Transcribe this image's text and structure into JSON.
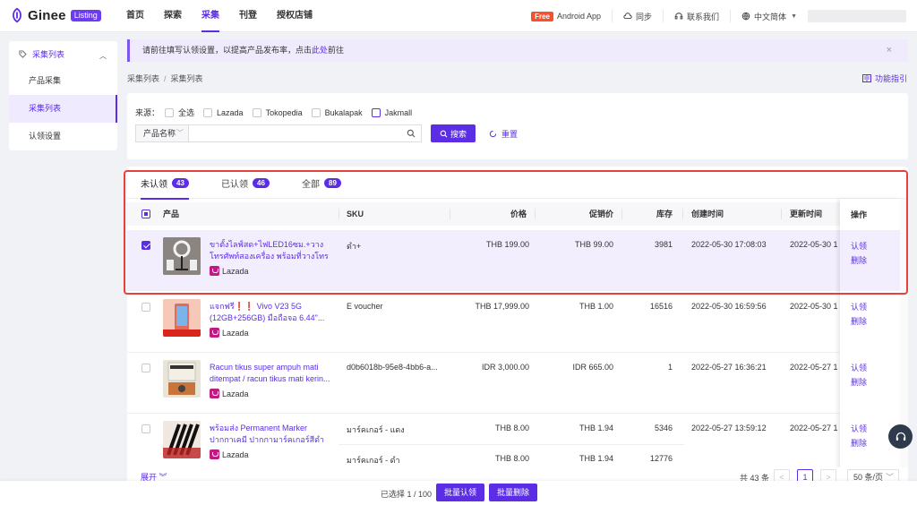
{
  "brand": {
    "name": "Ginee",
    "badge": "Listing",
    "color": "#5b2ee6"
  },
  "nav": [
    {
      "label": "首页"
    },
    {
      "label": "探索"
    },
    {
      "label": "采集",
      "active": true
    },
    {
      "label": "刊登"
    },
    {
      "label": "授权店铺"
    }
  ],
  "topright": {
    "free_badge": "Free",
    "app": "Android App",
    "sync": "同步",
    "contact": "联系我们",
    "language": "中文简体"
  },
  "sidebar": {
    "header": "采集列表",
    "items": [
      {
        "label": "产品采集"
      },
      {
        "label": "采集列表",
        "active": true
      },
      {
        "label": "认领设置"
      }
    ]
  },
  "notice": {
    "text": "请前往填写认领设置，以提高产品发布率，点击",
    "link": "此处",
    "suffix": "前往",
    "close": "×"
  },
  "breadcrumb": {
    "root": "采集列表",
    "sep": "/",
    "current": "采集列表"
  },
  "guide": "功能指引",
  "filter": {
    "source_label": "来源：",
    "options": [
      "全选",
      "Lazada",
      "Tokopedia",
      "Bukalapak",
      "Jakmall"
    ],
    "field_select": "产品名称",
    "search_placeholder": "",
    "search_button": "搜索",
    "reset_button": "重置"
  },
  "tabs": [
    {
      "label": "未认领",
      "count": "43",
      "active": true
    },
    {
      "label": "已认领",
      "count": "46"
    },
    {
      "label": "全部",
      "count": "89"
    }
  ],
  "table": {
    "headers": {
      "product": "产品",
      "sku": "SKU",
      "price": "价格",
      "promo": "促销价",
      "stock": "库存",
      "created": "创建时间",
      "updated": "更新时间",
      "action": "操作"
    },
    "rows": [
      {
        "name": "ขาตั้งไลฟ์สด+ไฟLED16ซม.+วางโทรศัพท์สองเครื่อง พร้อมที่วางโทรศั...",
        "platform": "Lazada",
        "sku": "ดำ+",
        "price": "THB 199.00",
        "promo": "THB 99.00",
        "stock": "3981",
        "created": "2022-05-30 17:08:03",
        "updated": "2022-05-30 1",
        "claim": "认领",
        "delete": "删除",
        "selected": true
      },
      {
        "name": "แจกฟรี❗️❗️ Vivo V23 5G (12GB+256GB) มือถือจอ 6.44\"...",
        "platform": "Lazada",
        "sku": "E voucher",
        "price": "THB 17,999.00",
        "promo": "THB 1.00",
        "stock": "16516",
        "created": "2022-05-30 16:59:56",
        "updated": "2022-05-30 1",
        "claim": "认领",
        "delete": "删除"
      },
      {
        "name": "Racun tikus super ampuh mati ditempat / racun tikus mati kerin...",
        "platform": "Lazada",
        "sku": "d0b6018b-95e8-4bb6-a...",
        "price": "IDR 3,000.00",
        "promo": "IDR 665.00",
        "stock": "1",
        "created": "2022-05-27 16:36:21",
        "updated": "2022-05-27 1",
        "claim": "认领",
        "delete": "删除"
      },
      {
        "name": "พร้อมส่ง Permanent Marker ปากกาเคมี ปากกามาร์คเกอร์สีดำ ปากกามา...",
        "platform": "Lazada",
        "sku": "มาร์คเกอร์ - แดง",
        "price": "THB 8.00",
        "promo": "THB 1.94",
        "stock": "5346",
        "created": "2022-05-27 13:59:12",
        "updated": "2022-05-27 1",
        "claim": "认领",
        "delete": "删除"
      }
    ],
    "partial_row": {
      "sku": "มาร์คเกอร์ - ดำ",
      "price": "THB 8.00",
      "promo": "THB 1.94",
      "stock": "12776"
    }
  },
  "pager": {
    "expand": "展开",
    "total": "共 43 条",
    "prev": "<",
    "page": "1",
    "next": ">",
    "size": "50 条/页"
  },
  "bottom": {
    "selected": "已选择 1 / 100",
    "claim_batch": "批量认领",
    "delete_batch": "批量删除"
  }
}
